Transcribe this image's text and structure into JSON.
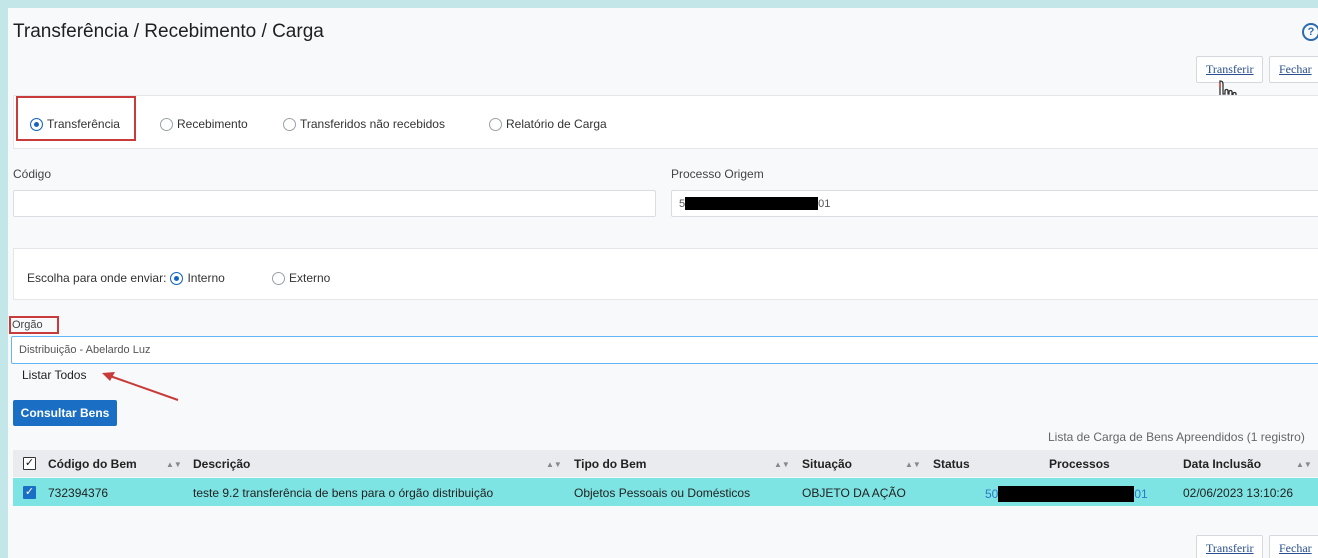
{
  "page": {
    "title": "Transferência / Recebimento / Carga",
    "help_icon": "help-circle-icon"
  },
  "toolbar": {
    "transferir": "Transferir",
    "fechar": "Fechar"
  },
  "modes": [
    {
      "label": "Transferência",
      "selected": true
    },
    {
      "label": "Recebimento",
      "selected": false
    },
    {
      "label": "Transferidos não recebidos",
      "selected": false
    },
    {
      "label": "Relatório de Carga",
      "selected": false
    }
  ],
  "form": {
    "codigo_label": "Código",
    "codigo_value": "",
    "processo_label": "Processo Origem",
    "processo_prefix": "5",
    "processo_suffix": "01",
    "envio_label": "Escolha para onde enviar:",
    "envio_interno": "Interno",
    "envio_externo": "Externo",
    "orgao_label": "Orgão",
    "orgao_value": "Distribuição - Abelardo Luz",
    "listar_todos": "Listar Todos",
    "consultar": "Consultar Bens"
  },
  "table": {
    "caption": "Lista de Carga de Bens Apreendidos (1 registro)",
    "columns": [
      "Código do Bem",
      "Descrição",
      "Tipo do Bem",
      "Situação",
      "Status",
      "Processos",
      "Data Inclusão"
    ],
    "rows": [
      {
        "codigo": "732394376",
        "descricao": "teste 9.2 transferência de bens para o órgão distribuição",
        "tipo": "Objetos Pessoais ou Domésticos",
        "situacao": "OBJETO DA AÇÃO",
        "status": "",
        "processo_prefix": "50",
        "processo_suffix": "01",
        "data": "02/06/2023 13:10:26"
      }
    ]
  },
  "colors": {
    "accent": "#1a6fc4",
    "row_highlight": "#7ee3e3",
    "annotation": "#c93a3a"
  }
}
